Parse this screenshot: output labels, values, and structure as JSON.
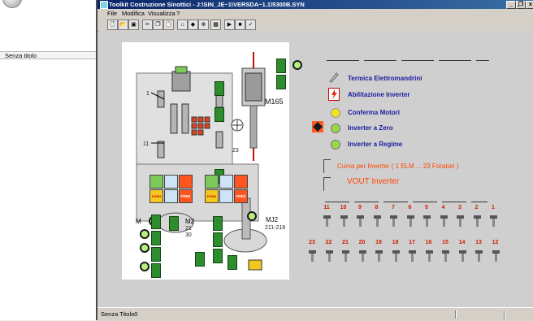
{
  "background_window": {
    "label": "Senza titolo"
  },
  "window": {
    "title": "Toolkit Costruzione Sinottici - J:\\SIN_JE~1\\VERSDA~1.1\\5300B.SYN",
    "controls": {
      "minimize": "_",
      "restore": "̱❒",
      "close": "x"
    }
  },
  "menu": [
    "File",
    "Modifica",
    "Visualizza",
    "?"
  ],
  "toolbar_icons": [
    "new-icon",
    "open-icon",
    "save-icon",
    "cut-icon",
    "copy-icon",
    "paste-icon",
    "tool-a-icon",
    "tool-b-icon",
    "tool-c-icon",
    "grid-icon",
    "run-icon",
    "stop-icon",
    "check-icon"
  ],
  "canvas": {
    "labels": {
      "m165": "M165",
      "mj2": "MJ2",
      "mj2_range": "211-218",
      "one": "1",
      "eleven": "11",
      "twentythree": "23",
      "m_left": "M",
      "m2": "M2",
      "m2_sub1": "21",
      "m2_sub2": "30",
      "push1": "PUSH",
      "free1": "FREE",
      "push2": "PUSH",
      "free2": "FREE"
    }
  },
  "legend": {
    "items": [
      {
        "label": "Termica Elettromandrini",
        "icon": "thermal-icon"
      },
      {
        "label": "Abilitazione Inverter",
        "icon": "inverter-enable-icon"
      },
      {
        "label": "Conferma Motori",
        "icon": "yellow-lamp-icon"
      },
      {
        "label": "Inverter a Zero",
        "icon": "green-lamp-icon"
      },
      {
        "label": "Inverter a Regime",
        "icon": "green-lamp-icon"
      }
    ],
    "curve_label": "Curva per Inverter ( 1 ELM ... 23 Foratori )",
    "vout_label": "VOUT Inverter"
  },
  "pins_top": [
    "11",
    "10",
    "9",
    "8",
    "7",
    "6",
    "5",
    "4",
    "3",
    "2",
    "1"
  ],
  "pins_bottom": [
    "23",
    "22",
    "21",
    "20",
    "19",
    "18",
    "17",
    "16",
    "15",
    "14",
    "13",
    "12"
  ],
  "statusbar": {
    "text": "Senza Titolo0"
  },
  "colors": {
    "title_bar": "#0a246a",
    "legend_text": "#1a1aa0",
    "accent_orange": "#ff4400",
    "pin_number": "#d02000"
  }
}
